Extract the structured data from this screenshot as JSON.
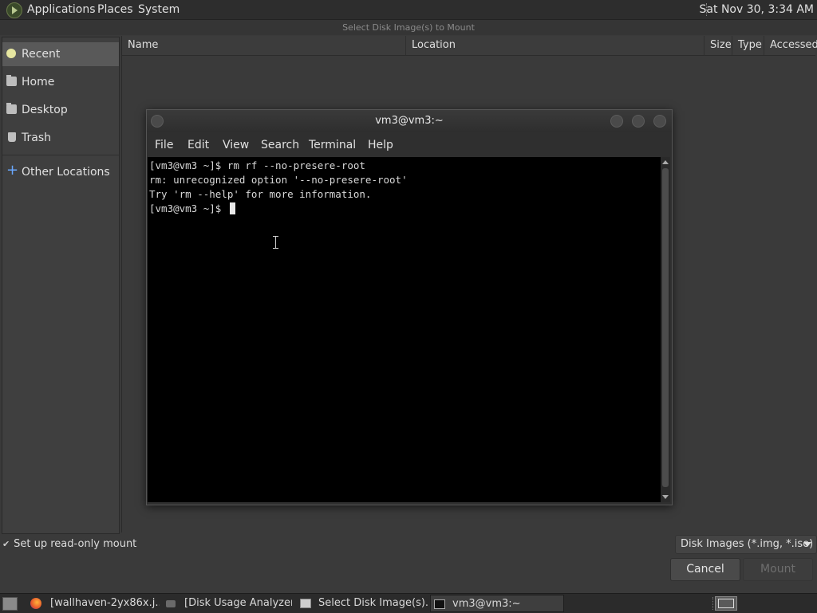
{
  "top_panel": {
    "menus": [
      "Applications",
      "Places",
      "System"
    ],
    "clock": "Sat Nov 30,  3:34 AM"
  },
  "dialog": {
    "title": "Select Disk Image(s) to Mount",
    "sidebar": {
      "items": [
        {
          "label": "Recent",
          "icon": "recent-icon",
          "active": true
        },
        {
          "label": "Home",
          "icon": "folder-icon"
        },
        {
          "label": "Desktop",
          "icon": "folder-icon"
        },
        {
          "label": "Trash",
          "icon": "trash-icon"
        },
        {
          "label": "Other Locations",
          "icon": "plus-icon"
        }
      ]
    },
    "columns": [
      "Name",
      "Location",
      "Size",
      "Type",
      "Accessed"
    ],
    "readonly_label": "Set up read-only mount",
    "readonly_checked": true,
    "filter": "Disk Images (*.img, *.iso)",
    "cancel_label": "Cancel",
    "mount_label": "Mount"
  },
  "terminal": {
    "title": "vm3@vm3:~",
    "menus": [
      "File",
      "Edit",
      "View",
      "Search",
      "Terminal",
      "Help"
    ],
    "lines": [
      "[vm3@vm3 ~]$ rm rf --no-presere-root",
      "rm: unrecognized option '--no-presere-root'",
      "Try 'rm --help' for more information.",
      "[vm3@vm3 ~]$ "
    ]
  },
  "taskbar": {
    "tasks": [
      {
        "label": "[wallhaven-2yx86x.j...",
        "icon": "firefox-icon"
      },
      {
        "label": "[Disk Usage Analyzer]",
        "icon": "disk-usage-icon"
      },
      {
        "label": "Select Disk Image(s)...",
        "icon": "window-icon"
      },
      {
        "label": "vm3@vm3:~",
        "icon": "terminal-icon",
        "active": true
      }
    ]
  }
}
